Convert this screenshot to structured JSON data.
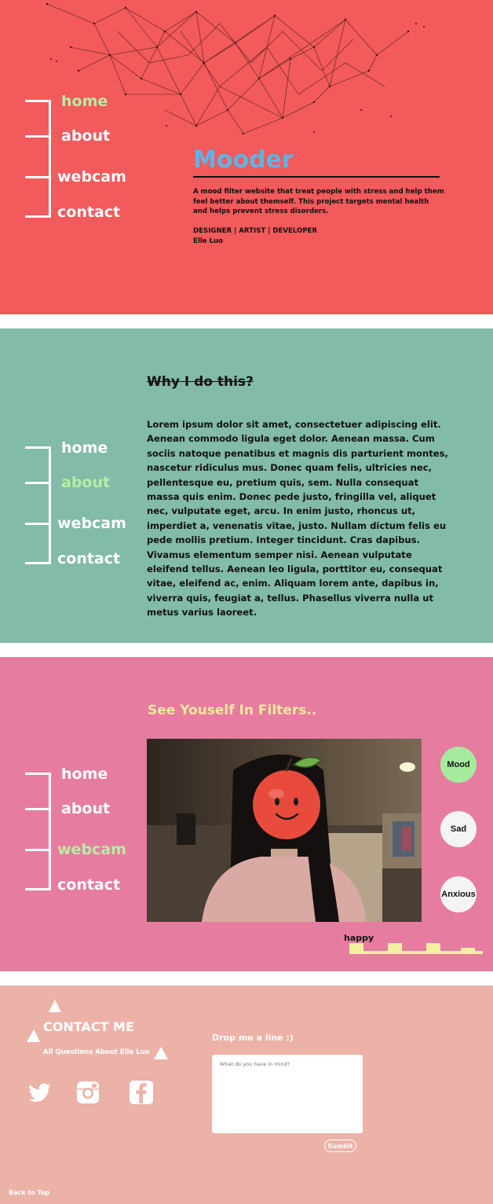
{
  "nav": {
    "items": [
      {
        "label": "home"
      },
      {
        "label": "about"
      },
      {
        "label": "webcam"
      },
      {
        "label": "contact"
      }
    ]
  },
  "home": {
    "title": "Mooder",
    "description": "A mood filter website that treat people with stress and help them feel better about themself. This project targets mental health and helps prevent stress disorders.",
    "roles": "DESIGNER | ARTIST | DEVELOPER",
    "author": "Elle Luo"
  },
  "about": {
    "heading": "Why I do this?",
    "body": "Lorem ipsum dolor sit amet, consectetuer adipiscing elit. Aenean commodo ligula eget dolor. Aenean massa. Cum sociis natoque penatibus et magnis dis parturient montes, nascetur ridiculus mus. Donec quam felis, ultricies nec, pellentesque eu, pretium quis, sem. Nulla consequat massa quis enim. Donec pede justo, fringilla vel, aliquet nec, vulputate eget, arcu. In enim justo, rhoncus ut, imperdiet a, venenatis vitae, justo. Nullam dictum felis eu pede mollis pretium. Integer tincidunt. Cras dapibus. Vivamus elementum semper nisi. Aenean vulputate eleifend tellus. Aenean leo ligula, porttitor eu, consequat vitae, eleifend ac, enim. Aliquam lorem ante, dapibus in, viverra quis, feugiat a, tellus. Phasellus viverra nulla ut metus varius laoreet."
  },
  "webcam": {
    "heading": "See Youself In Filters..",
    "buttons": [
      {
        "label": "Mood"
      },
      {
        "label": "Sad"
      },
      {
        "label": "Anxious"
      }
    ],
    "bar_label": "happy"
  },
  "contact": {
    "title": "CONTACT ME",
    "subtitle": "All Questions About Elle Luo",
    "drop_label": "Drop me a line :)",
    "placeholder": "What do you have in mind?",
    "submit_label": "Sumbit",
    "back_to_top": "Back to Top",
    "social": [
      "twitter-icon",
      "instagram-icon",
      "facebook-icon"
    ]
  },
  "colors": {
    "home_bg": "#f25a5b",
    "about_bg": "#82bba8",
    "webcam_bg": "#e67c9f",
    "contact_bg": "#ecb2a8",
    "active_nav": "#b6eda6",
    "title_blue": "#5fb3e6",
    "webcam_heading": "#f5e7a1"
  }
}
